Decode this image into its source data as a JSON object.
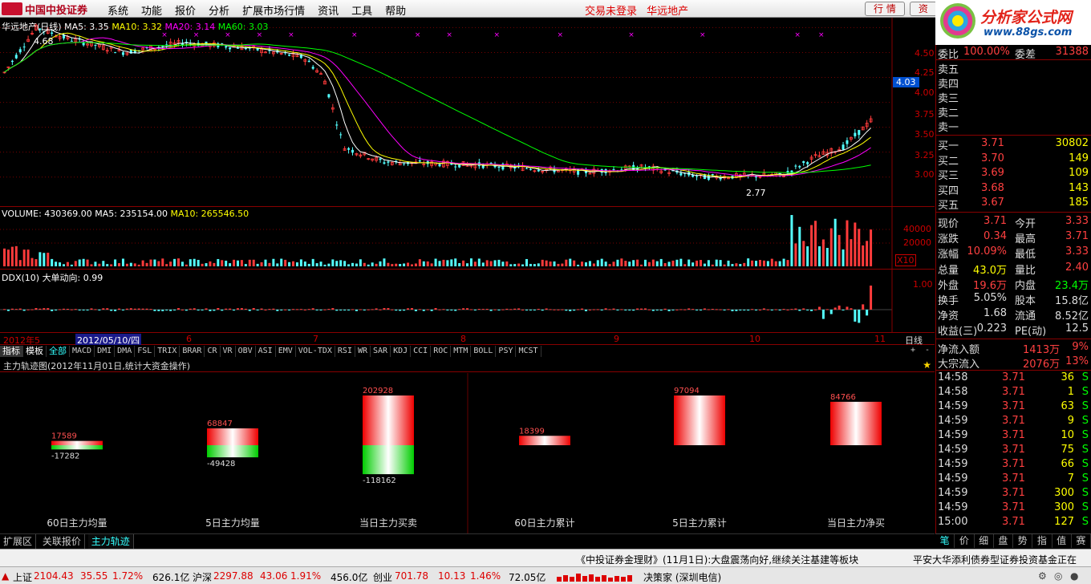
{
  "app": {
    "logo_text": "中国中投证券",
    "menu": [
      "系统",
      "功能",
      "报价",
      "分析",
      "扩展市场行情",
      "资讯",
      "工具",
      "帮助"
    ],
    "trade_status": "交易未登录",
    "stock_title": "华远地产",
    "top_buttons": [
      "行 情",
      "资"
    ],
    "brand_name": "分析家公式网",
    "brand_url": "www.88gs.com"
  },
  "kline": {
    "header": "华远地产(日线)",
    "ma5_label": "MA5: 3.35",
    "ma10_label": "MA10: 3.32",
    "ma20_label": "MA20: 3.14",
    "ma60_label": "MA60: 3.03",
    "high_mark": "4.68",
    "low_mark": "2.77",
    "current_price_tag": "4.03",
    "y_ticks": [
      "4.50",
      "4.25",
      "4.00",
      "3.75",
      "3.50",
      "3.25",
      "3.00"
    ],
    "colors": {
      "up": "#ff3b3b",
      "down": "#54ffff",
      "ma5": "#ffffff",
      "ma10": "#ffff00",
      "ma20": "#ff00ff",
      "ma60": "#00ff00"
    }
  },
  "volume": {
    "header": "VOLUME: 430369.00",
    "ma5_label": "MA5: 235154.00",
    "ma10_label": "MA10: 265546.50",
    "y_ticks": [
      "40000",
      "20000"
    ],
    "unit": "X10"
  },
  "ddx": {
    "header": "DDX(10)",
    "label": "大单动向: 0.99",
    "y_tick": "1.00"
  },
  "dates": {
    "labels": [
      "2012年5",
      "2012/05/10/四",
      "6",
      "7",
      "8",
      "9",
      "10",
      "11"
    ],
    "period": "日线"
  },
  "indicator_tabs": {
    "leading": [
      "指标",
      "模板",
      "全部"
    ],
    "items": [
      "MACD",
      "DMI",
      "DMA",
      "FSL",
      "TRIX",
      "BRAR",
      "CR",
      "VR",
      "OBV",
      "ASI",
      "EMV",
      "VOL-TDX",
      "RSI",
      "WR",
      "SAR",
      "KDJ",
      "CCI",
      "ROC",
      "MTM",
      "BOLL",
      "PSY",
      "MCST"
    ],
    "nav": [
      "+",
      "-"
    ]
  },
  "mainforce": {
    "title": "主力轨迹图(2012年11月01日,统计大资金操作)",
    "left_groups": [
      {
        "label": "60日主力均量",
        "buy": 17589,
        "sell": -17282
      },
      {
        "label": "5日主力均量",
        "buy": 68847,
        "sell": -49428
      },
      {
        "label": "当日主力买卖",
        "buy": 202928,
        "sell": -118162
      }
    ],
    "right_groups": [
      {
        "label": "60日主力累计",
        "value": 18399
      },
      {
        "label": "5日主力累计",
        "value": 97094
      },
      {
        "label": "当日主力净买",
        "value": 84766
      }
    ]
  },
  "bottom_tabs": [
    "扩展区",
    "关联报价",
    "主力轨迹"
  ],
  "quote": {
    "weibi_label": "委比",
    "weibi_value": "100.00%",
    "weicha_label": "委差",
    "weicha_value": "31388",
    "sell_labels": [
      "卖五",
      "卖四",
      "卖三",
      "卖二",
      "卖一"
    ],
    "buy_levels": [
      {
        "label": "买一",
        "price": "3.71",
        "vol": "30802"
      },
      {
        "label": "买二",
        "price": "3.70",
        "vol": "149"
      },
      {
        "label": "买三",
        "price": "3.69",
        "vol": "109"
      },
      {
        "label": "买四",
        "price": "3.68",
        "vol": "143"
      },
      {
        "label": "买五",
        "price": "3.67",
        "vol": "185"
      }
    ],
    "stats": [
      {
        "l1": "现价",
        "v1": "3.71",
        "l2": "今开",
        "v2": "3.33"
      },
      {
        "l1": "涨跌",
        "v1": "0.34",
        "l2": "最高",
        "v2": "3.71"
      },
      {
        "l1": "涨幅",
        "v1": "10.09%",
        "l2": "最低",
        "v2": "3.33"
      },
      {
        "l1": "总量",
        "v1": "43.0万",
        "l2": "量比",
        "v2": "2.40"
      },
      {
        "l1": "外盘",
        "v1": "19.6万",
        "l2": "内盘",
        "v2": "23.4万"
      },
      {
        "l1": "换手",
        "v1": "5.05%",
        "l2": "股本",
        "v2": "15.8亿"
      },
      {
        "l1": "净资",
        "v1": "1.68",
        "l2": "流通",
        "v2": "8.52亿"
      },
      {
        "l1": "收益(三)",
        "v1": "0.223",
        "l2": "PE(动)",
        "v2": "12.5"
      }
    ],
    "net_inflow_label": "净流入额",
    "net_inflow_value": "1413万",
    "net_inflow_pct": "9%",
    "block_inflow_label": "大宗流入",
    "block_inflow_value": "2076万",
    "block_inflow_pct": "13%",
    "ticks": [
      {
        "time": "14:58",
        "price": "3.71",
        "vol": "36",
        "side": "S"
      },
      {
        "time": "14:58",
        "price": "3.71",
        "vol": "1",
        "side": "S"
      },
      {
        "time": "14:59",
        "price": "3.71",
        "vol": "63",
        "side": "S"
      },
      {
        "time": "14:59",
        "price": "3.71",
        "vol": "9",
        "side": "S"
      },
      {
        "time": "14:59",
        "price": "3.71",
        "vol": "10",
        "side": "S"
      },
      {
        "time": "14:59",
        "price": "3.71",
        "vol": "75",
        "side": "S"
      },
      {
        "time": "14:59",
        "price": "3.71",
        "vol": "66",
        "side": "S"
      },
      {
        "time": "14:59",
        "price": "3.71",
        "vol": "7",
        "side": "S"
      },
      {
        "time": "14:59",
        "price": "3.71",
        "vol": "300",
        "side": "S"
      },
      {
        "time": "14:59",
        "price": "3.71",
        "vol": "300",
        "side": "S"
      },
      {
        "time": "15:00",
        "price": "3.71",
        "vol": "127",
        "side": "S"
      }
    ],
    "tabs": [
      "笔",
      "价",
      "细",
      "盘",
      "势",
      "指",
      "值",
      "赛"
    ]
  },
  "ticker": {
    "news": "《中投证券金理财》(11月1日):大盘震荡向好,继续关注基建等板块",
    "news2": "平安大华添利债券型证券投资基金正在"
  },
  "status": {
    "sh_label": "上证",
    "sh_value": "2104.43",
    "sh_chg": "35.55",
    "sh_pct": "1.72%",
    "sh_amt": "626.1亿",
    "sz_label": "沪深",
    "sz_value": "2297.88",
    "sz_chg": "43.06",
    "sz_pct": "1.91%",
    "sz_amt": "456.0亿",
    "cy_label": "创业",
    "cy_value": "701.78",
    "cy_chg": "10.13",
    "cy_pct": "1.46%",
    "cy_amt": "72.05亿",
    "server": "决策家 (深圳电信)"
  }
}
